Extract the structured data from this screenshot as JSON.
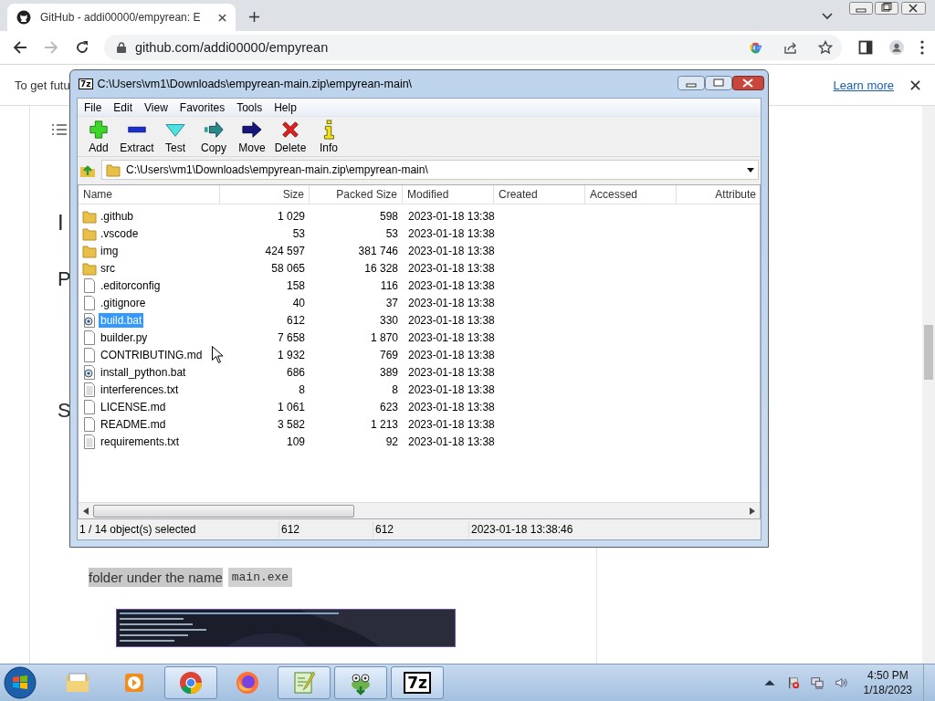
{
  "browser": {
    "tab_title": "GitHub - addi00000/empyrean: E",
    "url": "github.com/addi00000/empyrean"
  },
  "infobar": {
    "text": "To get futu",
    "link": "Learn more"
  },
  "page": {
    "heading_fragments": [
      "I",
      "P",
      "S"
    ],
    "paragraph": "folder under the name",
    "code": "main.exe",
    "image": {
      "kind": "picture"
    }
  },
  "archive_window": {
    "title": "C:\\Users\\vm1\\Downloads\\empyrean-main.zip\\empyrean-main\\",
    "title_icon": "7z",
    "menu": [
      "File",
      "Edit",
      "View",
      "Favorites",
      "Tools",
      "Help"
    ],
    "toolbar": [
      {
        "label": "Add",
        "kind": "add"
      },
      {
        "label": "Extract",
        "kind": "extract"
      },
      {
        "label": "Test",
        "kind": "test"
      },
      {
        "label": "Copy",
        "kind": "copy"
      },
      {
        "label": "Move",
        "kind": "move"
      },
      {
        "label": "Delete",
        "kind": "delete"
      },
      {
        "label": "Info",
        "kind": "info"
      }
    ],
    "address": "C:\\Users\\vm1\\Downloads\\empyrean-main.zip\\empyrean-main\\",
    "columns": [
      "Name",
      "Size",
      "Packed Size",
      "Modified",
      "Created",
      "Accessed",
      "Attribute"
    ],
    "rows": [
      {
        "name": ".github",
        "kind": "folder",
        "size": "1 029",
        "packed": "598",
        "modified": "2023-01-18 13:38",
        "selected": false
      },
      {
        "name": ".vscode",
        "kind": "folder",
        "size": "53",
        "packed": "53",
        "modified": "2023-01-18 13:38",
        "selected": false
      },
      {
        "name": "img",
        "kind": "folder",
        "size": "424 597",
        "packed": "381 746",
        "modified": "2023-01-18 13:38",
        "selected": false
      },
      {
        "name": "src",
        "kind": "folder",
        "size": "58 065",
        "packed": "16 328",
        "modified": "2023-01-18 13:38",
        "selected": false
      },
      {
        "name": ".editorconfig",
        "kind": "file",
        "size": "158",
        "packed": "116",
        "modified": "2023-01-18 13:38",
        "selected": false
      },
      {
        "name": ".gitignore",
        "kind": "file",
        "size": "40",
        "packed": "37",
        "modified": "2023-01-18 13:38",
        "selected": false
      },
      {
        "name": "build.bat",
        "kind": "script",
        "size": "612",
        "packed": "330",
        "modified": "2023-01-18 13:38",
        "selected": true
      },
      {
        "name": "builder.py",
        "kind": "file",
        "size": "7 658",
        "packed": "1 870",
        "modified": "2023-01-18 13:38",
        "selected": false
      },
      {
        "name": "CONTRIBUTING.md",
        "kind": "file",
        "size": "1 932",
        "packed": "769",
        "modified": "2023-01-18 13:38",
        "selected": false
      },
      {
        "name": "install_python.bat",
        "kind": "script",
        "size": "686",
        "packed": "389",
        "modified": "2023-01-18 13:38",
        "selected": false
      },
      {
        "name": "interferences.txt",
        "kind": "text",
        "size": "8",
        "packed": "8",
        "modified": "2023-01-18 13:38",
        "selected": false
      },
      {
        "name": "LICENSE.md",
        "kind": "file",
        "size": "1 061",
        "packed": "623",
        "modified": "2023-01-18 13:38",
        "selected": false
      },
      {
        "name": "README.md",
        "kind": "file",
        "size": "3 582",
        "packed": "1 213",
        "modified": "2023-01-18 13:38",
        "selected": false
      },
      {
        "name": "requirements.txt",
        "kind": "text",
        "size": "109",
        "packed": "92",
        "modified": "2023-01-18 13:38",
        "selected": false
      }
    ],
    "status": [
      "1 / 14 object(s) selected",
      "612",
      "612",
      "2023-01-18 13:38:46"
    ]
  },
  "taskbar": {
    "apps": [
      {
        "kind": "explorer",
        "open": false
      },
      {
        "kind": "media",
        "open": false
      },
      {
        "kind": "chrome",
        "open": true
      },
      {
        "kind": "firefox",
        "open": false
      },
      {
        "kind": "notepad",
        "open": true
      },
      {
        "kind": "frog",
        "open": true
      },
      {
        "kind": "sevenzip",
        "open": true,
        "label": "7z"
      }
    ],
    "time": "4:50 PM",
    "date": "1/18/2023"
  }
}
